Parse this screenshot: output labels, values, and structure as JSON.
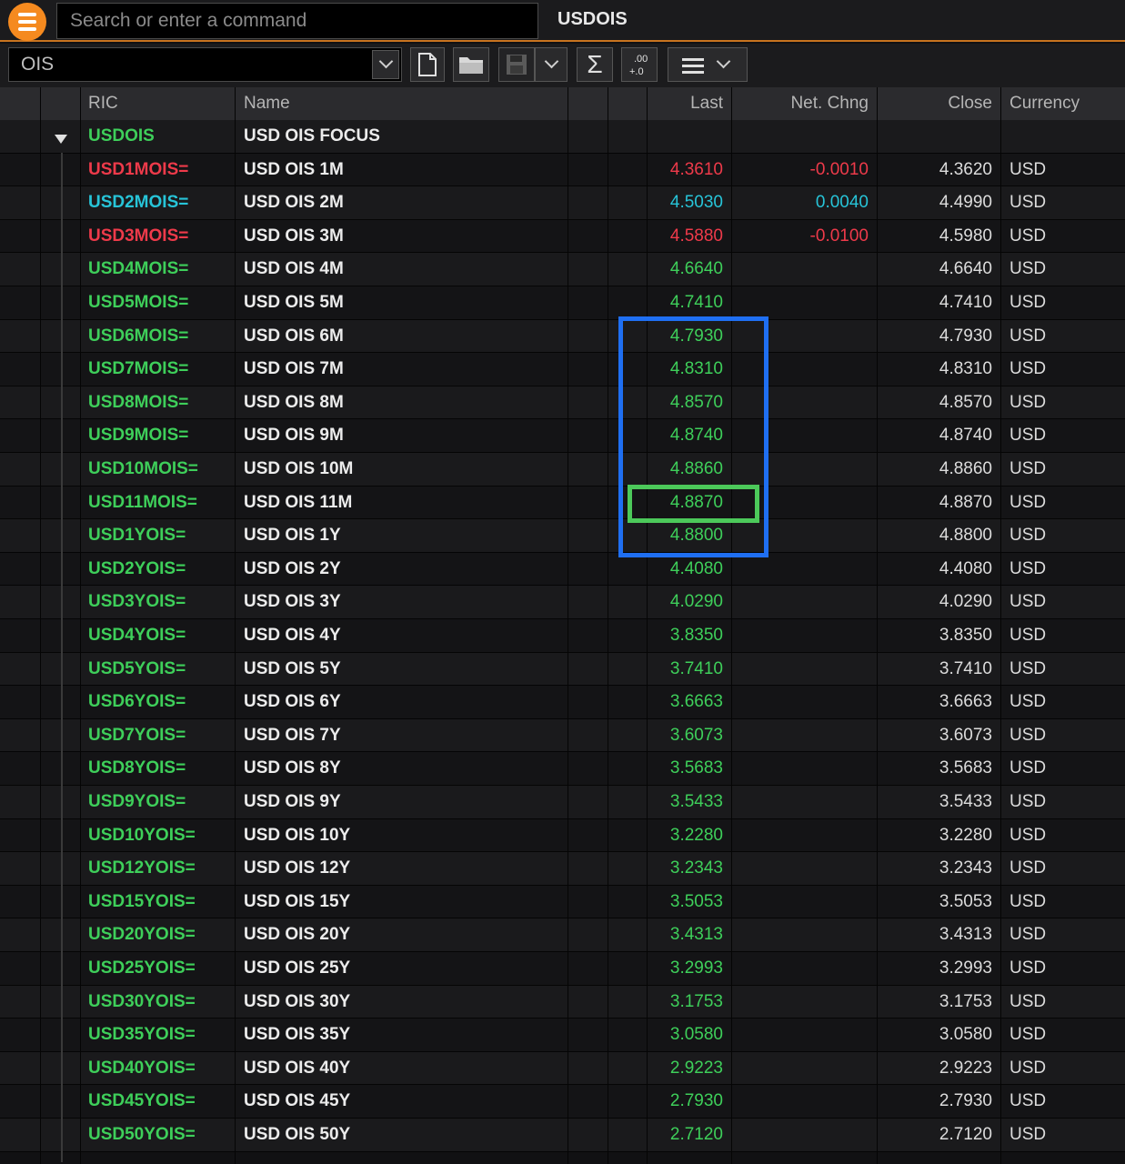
{
  "search": {
    "placeholder": "Search or enter a command"
  },
  "window_title": "USDOIS",
  "toolbar": {
    "ric_value": "OIS",
    "format_label": ".00\n+.0",
    "sigma_label": "Σ"
  },
  "columns": {
    "ric": "RIC",
    "name": "Name",
    "last": "Last",
    "net": "Net. Chng",
    "close": "Close",
    "currency": "Currency"
  },
  "colors": {
    "green": "#3ecf5a",
    "red": "#ee3a4a",
    "cyan": "#27c4d8",
    "highlight_blue": "#1f6ff2",
    "highlight_green": "#4cc95a"
  },
  "group": {
    "ric": "USDOIS",
    "name": "USD OIS FOCUS"
  },
  "rows": [
    {
      "ric": "USD1MOIS=",
      "name": "USD OIS 1M",
      "last": "4.3610",
      "net": "-0.0010",
      "close": "4.3620",
      "cur": "USD",
      "tone": "red"
    },
    {
      "ric": "USD2MOIS=",
      "name": "USD OIS 2M",
      "last": "4.5030",
      "net": "0.0040",
      "close": "4.4990",
      "cur": "USD",
      "tone": "cyan"
    },
    {
      "ric": "USD3MOIS=",
      "name": "USD OIS 3M",
      "last": "4.5880",
      "net": "-0.0100",
      "close": "4.5980",
      "cur": "USD",
      "tone": "red"
    },
    {
      "ric": "USD4MOIS=",
      "name": "USD OIS 4M",
      "last": "4.6640",
      "net": "",
      "close": "4.6640",
      "cur": "USD",
      "tone": "green"
    },
    {
      "ric": "USD5MOIS=",
      "name": "USD OIS 5M",
      "last": "4.7410",
      "net": "",
      "close": "4.7410",
      "cur": "USD",
      "tone": "green"
    },
    {
      "ric": "USD6MOIS=",
      "name": "USD OIS 6M",
      "last": "4.7930",
      "net": "",
      "close": "4.7930",
      "cur": "USD",
      "tone": "green"
    },
    {
      "ric": "USD7MOIS=",
      "name": "USD OIS 7M",
      "last": "4.8310",
      "net": "",
      "close": "4.8310",
      "cur": "USD",
      "tone": "green"
    },
    {
      "ric": "USD8MOIS=",
      "name": "USD OIS 8M",
      "last": "4.8570",
      "net": "",
      "close": "4.8570",
      "cur": "USD",
      "tone": "green"
    },
    {
      "ric": "USD9MOIS=",
      "name": "USD OIS 9M",
      "last": "4.8740",
      "net": "",
      "close": "4.8740",
      "cur": "USD",
      "tone": "green"
    },
    {
      "ric": "USD10MOIS=",
      "name": "USD OIS 10M",
      "last": "4.8860",
      "net": "",
      "close": "4.8860",
      "cur": "USD",
      "tone": "green"
    },
    {
      "ric": "USD11MOIS=",
      "name": "USD OIS 11M",
      "last": "4.8870",
      "net": "",
      "close": "4.8870",
      "cur": "USD",
      "tone": "green"
    },
    {
      "ric": "USD1YOIS=",
      "name": "USD OIS 1Y",
      "last": "4.8800",
      "net": "",
      "close": "4.8800",
      "cur": "USD",
      "tone": "green"
    },
    {
      "ric": "USD2YOIS=",
      "name": "USD OIS 2Y",
      "last": "4.4080",
      "net": "",
      "close": "4.4080",
      "cur": "USD",
      "tone": "green"
    },
    {
      "ric": "USD3YOIS=",
      "name": "USD OIS 3Y",
      "last": "4.0290",
      "net": "",
      "close": "4.0290",
      "cur": "USD",
      "tone": "green"
    },
    {
      "ric": "USD4YOIS=",
      "name": "USD OIS 4Y",
      "last": "3.8350",
      "net": "",
      "close": "3.8350",
      "cur": "USD",
      "tone": "green"
    },
    {
      "ric": "USD5YOIS=",
      "name": "USD OIS 5Y",
      "last": "3.7410",
      "net": "",
      "close": "3.7410",
      "cur": "USD",
      "tone": "green"
    },
    {
      "ric": "USD6YOIS=",
      "name": "USD OIS 6Y",
      "last": "3.6663",
      "net": "",
      "close": "3.6663",
      "cur": "USD",
      "tone": "green"
    },
    {
      "ric": "USD7YOIS=",
      "name": "USD OIS 7Y",
      "last": "3.6073",
      "net": "",
      "close": "3.6073",
      "cur": "USD",
      "tone": "green"
    },
    {
      "ric": "USD8YOIS=",
      "name": "USD OIS 8Y",
      "last": "3.5683",
      "net": "",
      "close": "3.5683",
      "cur": "USD",
      "tone": "green"
    },
    {
      "ric": "USD9YOIS=",
      "name": "USD OIS 9Y",
      "last": "3.5433",
      "net": "",
      "close": "3.5433",
      "cur": "USD",
      "tone": "green"
    },
    {
      "ric": "USD10YOIS=",
      "name": "USD OIS 10Y",
      "last": "3.2280",
      "net": "",
      "close": "3.2280",
      "cur": "USD",
      "tone": "green"
    },
    {
      "ric": "USD12YOIS=",
      "name": "USD OIS 12Y",
      "last": "3.2343",
      "net": "",
      "close": "3.2343",
      "cur": "USD",
      "tone": "green"
    },
    {
      "ric": "USD15YOIS=",
      "name": "USD OIS 15Y",
      "last": "3.5053",
      "net": "",
      "close": "3.5053",
      "cur": "USD",
      "tone": "green"
    },
    {
      "ric": "USD20YOIS=",
      "name": "USD OIS 20Y",
      "last": "3.4313",
      "net": "",
      "close": "3.4313",
      "cur": "USD",
      "tone": "green"
    },
    {
      "ric": "USD25YOIS=",
      "name": "USD OIS 25Y",
      "last": "3.2993",
      "net": "",
      "close": "3.2993",
      "cur": "USD",
      "tone": "green"
    },
    {
      "ric": "USD30YOIS=",
      "name": "USD OIS 30Y",
      "last": "3.1753",
      "net": "",
      "close": "3.1753",
      "cur": "USD",
      "tone": "green"
    },
    {
      "ric": "USD35YOIS=",
      "name": "USD OIS 35Y",
      "last": "3.0580",
      "net": "",
      "close": "3.0580",
      "cur": "USD",
      "tone": "green"
    },
    {
      "ric": "USD40YOIS=",
      "name": "USD OIS 40Y",
      "last": "2.9223",
      "net": "",
      "close": "2.9223",
      "cur": "USD",
      "tone": "green"
    },
    {
      "ric": "USD45YOIS=",
      "name": "USD OIS 45Y",
      "last": "2.7930",
      "net": "",
      "close": "2.7930",
      "cur": "USD",
      "tone": "green"
    },
    {
      "ric": "USD50YOIS=",
      "name": "USD OIS 50Y",
      "last": "2.7120",
      "net": "",
      "close": "2.7120",
      "cur": "USD",
      "tone": "green"
    }
  ]
}
